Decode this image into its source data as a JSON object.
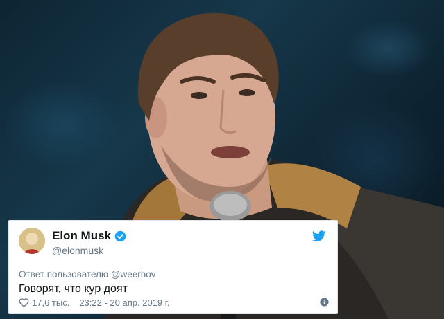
{
  "tweet": {
    "display_name": "Elon Musk",
    "handle": "@elonmusk",
    "reply_prefix": "Ответ пользователю",
    "reply_mention": "@weerhov",
    "text": "Говорят, что кур доят",
    "likes": "17,6 тыс.",
    "timestamp": "23:22 - 20 апр. 2019 г."
  },
  "icons": {
    "verified": "verified-badge-icon",
    "brand": "twitter-bird-icon",
    "like": "heart-icon",
    "info": "info-icon"
  },
  "colors": {
    "twitter_blue": "#1da1f2",
    "text_primary": "#14171a",
    "text_secondary": "#657786",
    "card_background": "#ffffff"
  }
}
